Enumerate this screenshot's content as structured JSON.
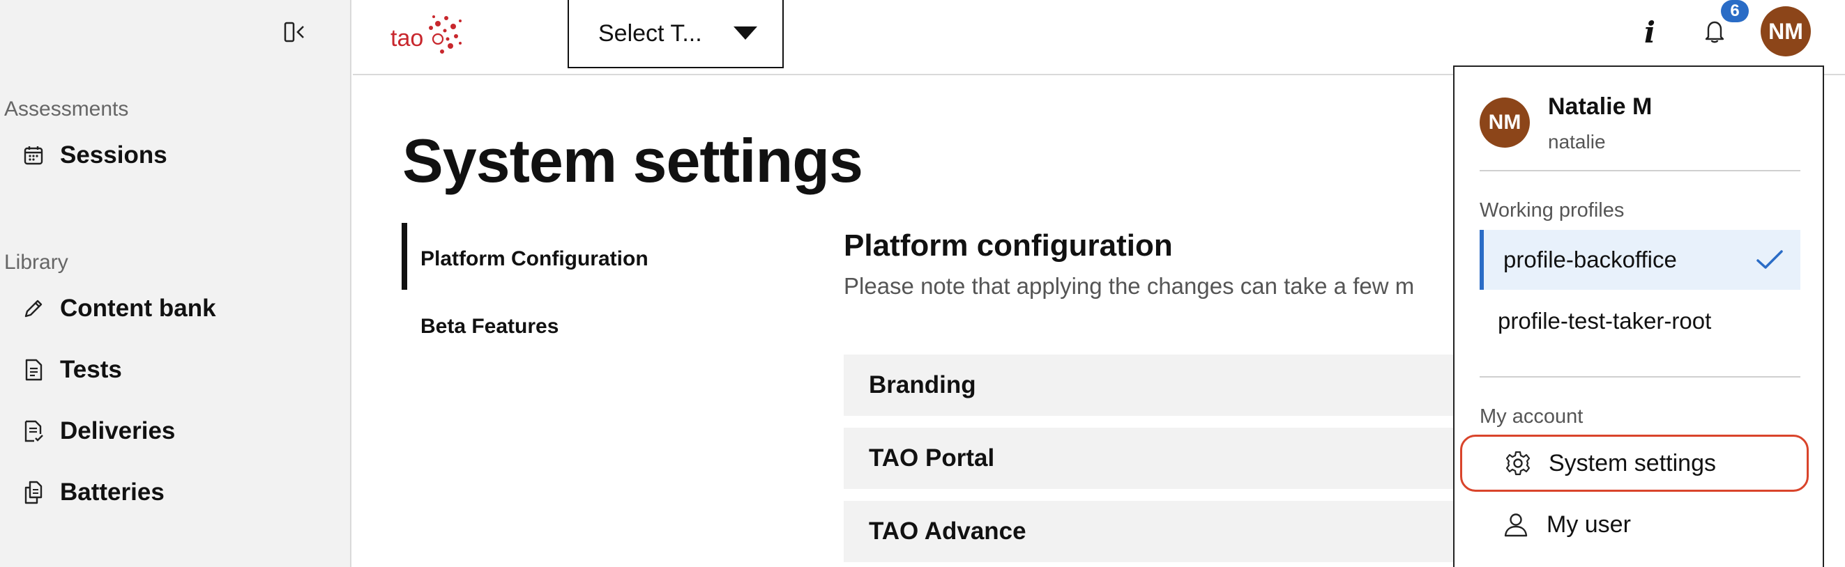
{
  "sidebar": {
    "collapse_icon": "sidebar-collapse-icon",
    "sections": [
      {
        "label": "Assessments",
        "items": [
          {
            "label": "Sessions",
            "icon": "calendar-icon"
          }
        ]
      },
      {
        "label": "Library",
        "items": [
          {
            "label": "Content bank",
            "icon": "pencil-icon"
          },
          {
            "label": "Tests",
            "icon": "document-icon"
          },
          {
            "label": "Deliveries",
            "icon": "document-check-icon"
          },
          {
            "label": "Batteries",
            "icon": "documents-icon"
          }
        ]
      }
    ]
  },
  "header": {
    "logo_text": "tao",
    "select_label": "Select T...",
    "info_icon": "info-icon",
    "bell_icon": "bell-icon",
    "notification_count": "6",
    "avatar_initials": "NM"
  },
  "main": {
    "title": "System settings",
    "settings_nav": [
      {
        "label": "Platform Configuration",
        "active": true
      },
      {
        "label": "Beta Features",
        "active": false
      }
    ],
    "section_title": "Platform configuration",
    "section_note": "Please note that applying the changes can take a few m",
    "accordions": [
      "Branding",
      "TAO Portal",
      "TAO Advance"
    ]
  },
  "user_menu": {
    "avatar_initials": "NM",
    "name": "Natalie M",
    "login": "natalie",
    "working_profiles_label": "Working profiles",
    "profiles": [
      {
        "label": "profile-backoffice",
        "selected": true
      },
      {
        "label": "profile-test-taker-root",
        "selected": false
      }
    ],
    "my_account_label": "My account",
    "actions": [
      {
        "label": "System settings",
        "icon": "gear-icon"
      },
      {
        "label": "My user",
        "icon": "user-icon"
      }
    ]
  },
  "colors": {
    "accent": "#2a6cc6",
    "avatar": "#8c4519",
    "logo_red": "#c8272d",
    "focus_ring": "#d9442b"
  }
}
